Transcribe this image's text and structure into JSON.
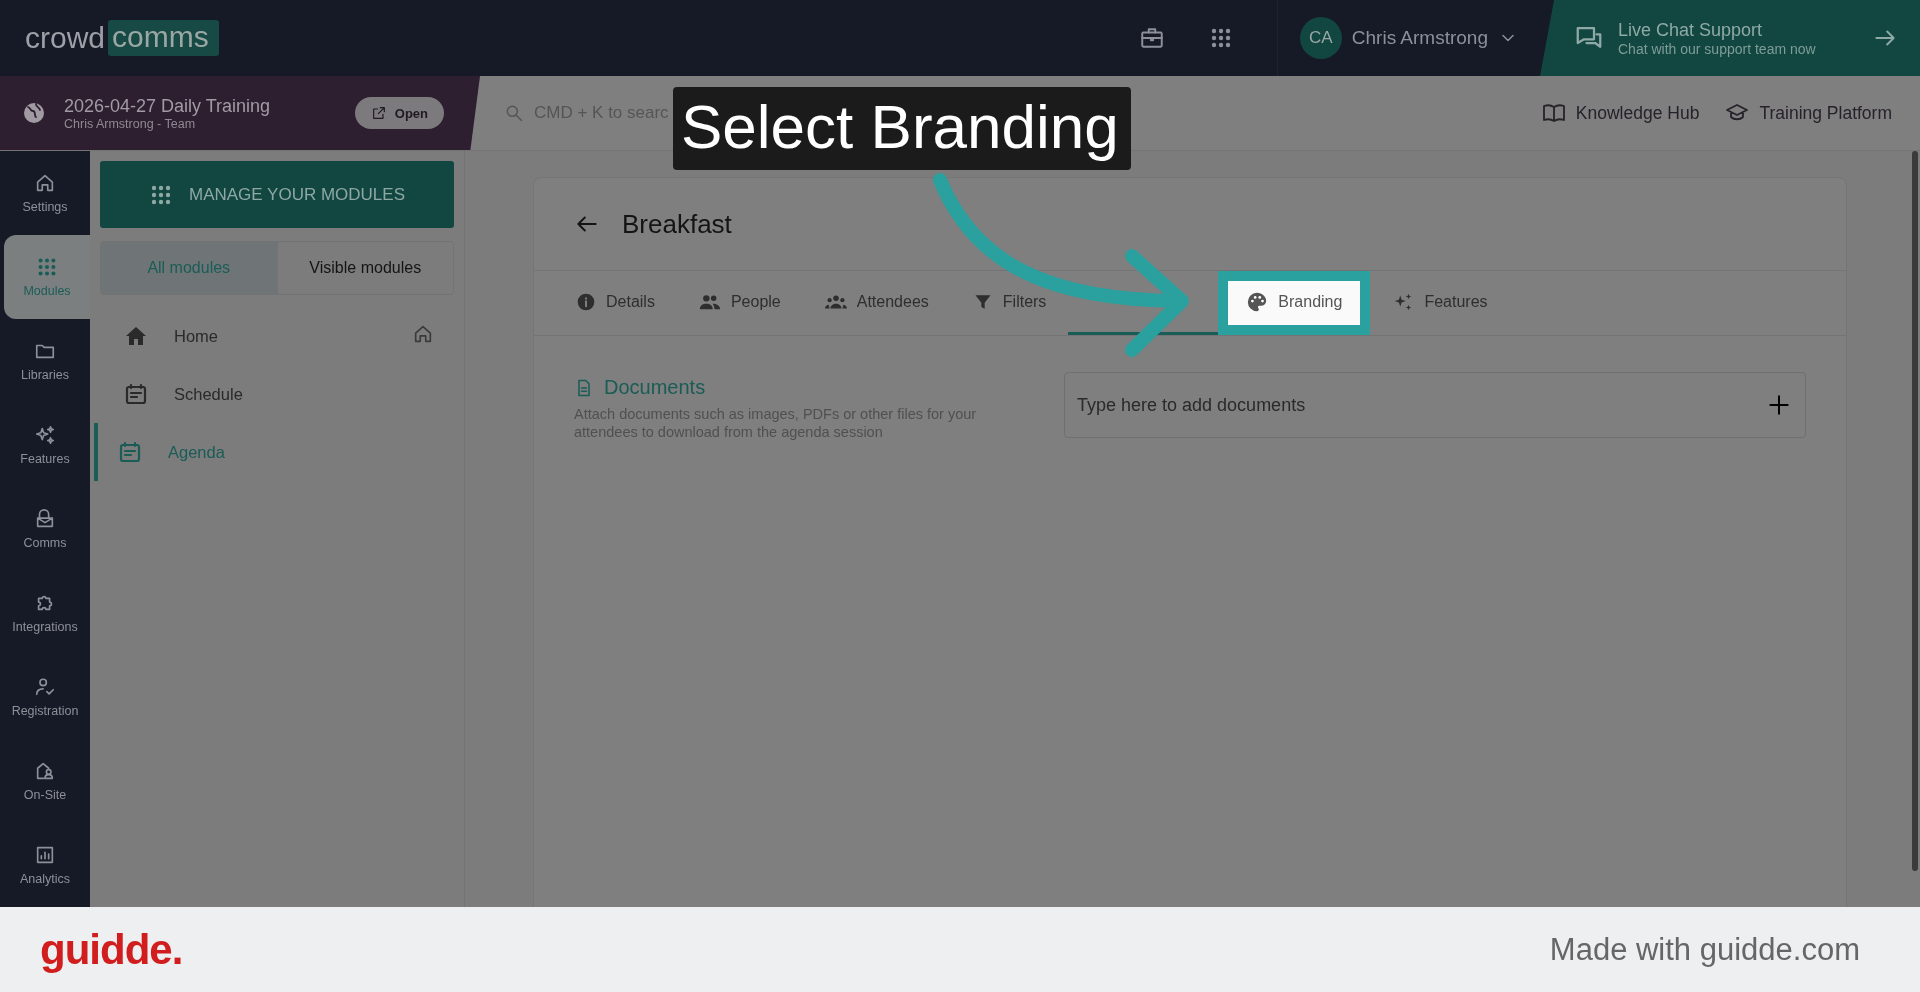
{
  "header": {
    "logo": {
      "word1": "crowd",
      "word2": "comms"
    },
    "user": {
      "initials": "CA",
      "name": "Chris Armstrong"
    },
    "support": {
      "title": "Live Chat Support",
      "subtitle": "Chat with our support team now"
    }
  },
  "event": {
    "title": "2026-04-27 Daily Training",
    "subtitle": "Chris Armstrong - Team",
    "button": "Open"
  },
  "search": {
    "placeholder": "CMD + K to searc"
  },
  "links": [
    {
      "label": "Knowledge Hub"
    },
    {
      "label": "Training Platform"
    }
  ],
  "rail": [
    {
      "label": "Settings",
      "selected": false
    },
    {
      "label": "Modules",
      "selected": true
    },
    {
      "label": "Libraries",
      "selected": false
    },
    {
      "label": "Features",
      "selected": false
    },
    {
      "label": "Comms",
      "selected": false
    },
    {
      "label": "Integrations",
      "selected": false
    },
    {
      "label": "Registration",
      "selected": false
    },
    {
      "label": "On-Site",
      "selected": false
    },
    {
      "label": "Analytics",
      "selected": false
    }
  ],
  "modules_panel": {
    "manage_button": "MANAGE YOUR MODULES",
    "filters": [
      {
        "label": "All modules",
        "selected": true
      },
      {
        "label": "Visible modules",
        "selected": false
      }
    ],
    "items": [
      {
        "label": "Home",
        "selected": false,
        "is_home": true
      },
      {
        "label": "Schedule",
        "selected": false,
        "is_home": false
      },
      {
        "label": "Agenda",
        "selected": true,
        "is_home": false
      }
    ]
  },
  "page": {
    "title": "Breakfast",
    "tabs": [
      {
        "label": "Details",
        "selected": false,
        "highlighted": false
      },
      {
        "label": "People",
        "selected": false,
        "highlighted": false
      },
      {
        "label": "Attendees",
        "selected": false,
        "highlighted": false
      },
      {
        "label": "Filters",
        "selected": false,
        "highlighted": false
      },
      {
        "selected": true,
        "highlighted": false
      },
      {
        "label": "Branding",
        "selected": false,
        "highlighted": true
      },
      {
        "label": "Features",
        "selected": false,
        "highlighted": false
      }
    ],
    "documents": {
      "title": "Documents",
      "description": "Attach documents such as images, PDFs or other files for your attendees to download from the agenda session",
      "placeholder": "Type here to add documents"
    }
  },
  "callout": {
    "text": "Select Branding"
  },
  "footer": {
    "brand": "guidde.",
    "credit": "Made with guidde.com"
  }
}
